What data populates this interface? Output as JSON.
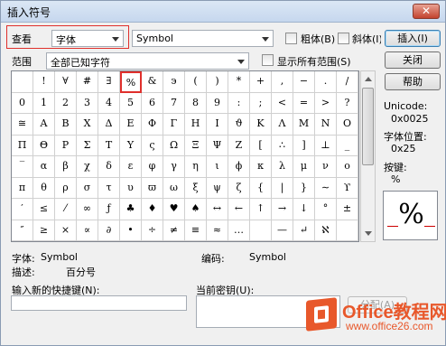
{
  "window": {
    "title": "插入符号",
    "close_label": "✕"
  },
  "toolbar": {
    "view_label": "查看",
    "view_value": "字体",
    "font_value": "Symbol",
    "bold_label": "粗体(B)",
    "italic_label": "斜体(I)"
  },
  "range": {
    "label": "范围",
    "value": "全部已知字符",
    "show_all_label": "显示所有范围(S)"
  },
  "buttons": {
    "insert": "插入(I)",
    "close": "关闭",
    "help": "帮助",
    "assign": "分配(A)"
  },
  "side": {
    "unicode_label": "Unicode:",
    "unicode_value": "0x0025",
    "position_label": "字体位置:",
    "position_value": "0x25",
    "key_label": "按键:",
    "key_value": "%",
    "preview_char": "%"
  },
  "grid": {
    "rows": [
      [
        "",
        "!",
        "∀",
        "#",
        "∃",
        "%",
        "&",
        "϶",
        "(",
        ")",
        "*",
        "+",
        ",",
        "−",
        ".",
        "/"
      ],
      [
        "0",
        "1",
        "2",
        "3",
        "4",
        "5",
        "6",
        "7",
        "8",
        "9",
        ":",
        ";",
        "<",
        "=",
        ">",
        "?"
      ],
      [
        "≅",
        "Α",
        "Β",
        "Χ",
        "Δ",
        "Ε",
        "Φ",
        "Γ",
        "Η",
        "Ι",
        "ϑ",
        "Κ",
        "Λ",
        "Μ",
        "Ν",
        "Ο"
      ],
      [
        "Π",
        "Θ",
        "Ρ",
        "Σ",
        "Τ",
        "Υ",
        "ς",
        "Ω",
        "Ξ",
        "Ψ",
        "Ζ",
        "[",
        "∴",
        "]",
        "⊥",
        "_"
      ],
      [
        "‾",
        "α",
        "β",
        "χ",
        "δ",
        "ε",
        "φ",
        "γ",
        "η",
        "ι",
        "ϕ",
        "κ",
        "λ",
        "μ",
        "ν",
        "ο"
      ],
      [
        "π",
        "θ",
        "ρ",
        "σ",
        "τ",
        "υ",
        "ϖ",
        "ω",
        "ξ",
        "ψ",
        "ζ",
        "{",
        "|",
        "}",
        "∼",
        "ϒ"
      ],
      [
        "′",
        "≤",
        "⁄",
        "∞",
        "ƒ",
        "♣",
        "♦",
        "♥",
        "♠",
        "↔",
        "←",
        "↑",
        "→",
        "↓",
        "°",
        "±"
      ],
      [
        "″",
        "≥",
        "×",
        "∝",
        "∂",
        "•",
        "÷",
        "≠",
        "≡",
        "≈",
        "…",
        "",
        "—",
        "↵",
        "ℵ",
        ""
      ]
    ],
    "selected": "%"
  },
  "info": {
    "font_label": "字体:",
    "font_value": "Symbol",
    "code_label": "编码:",
    "code_value": "Symbol",
    "desc_label": "描述:",
    "desc_value": "百分号"
  },
  "shortcut": {
    "new_label": "输入新的快捷键(N):",
    "current_label": "当前密钥(U):"
  },
  "logo": {
    "brand": "Office教程网",
    "url": "www.office26.com"
  }
}
